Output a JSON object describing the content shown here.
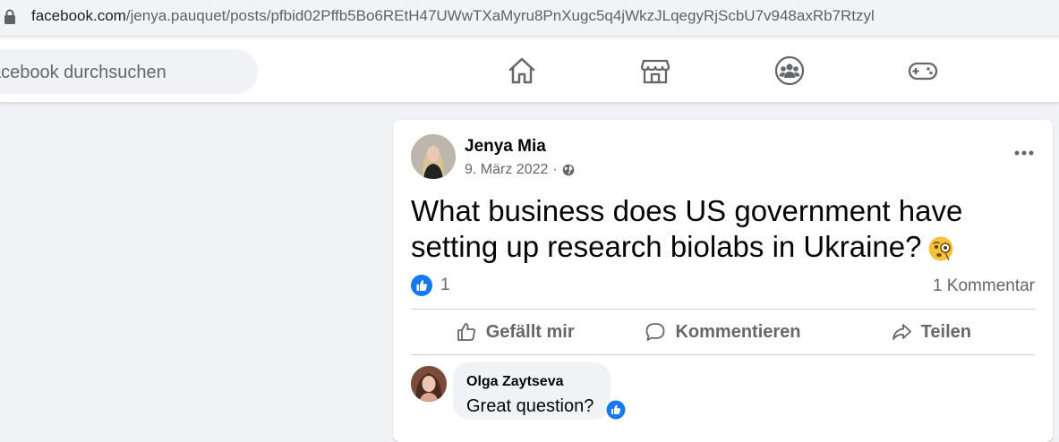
{
  "browser": {
    "url_domain": "facebook.com",
    "url_path": "/jenya.pauquet/posts/pfbid02Pffb5Bo6REtH47UWwTXaMyru8PnXugc5q4jWkzJLqegyRjScbU7v948axRb7Rtzyl"
  },
  "header": {
    "search_placeholder": "acebook durchsuchen",
    "nav": [
      "home-icon",
      "marketplace-icon",
      "groups-icon",
      "gaming-icon"
    ]
  },
  "post": {
    "author": "Jenya Mia",
    "date": "9. März 2022",
    "separator": "·",
    "text": "What business does US government have setting up research biolabs in Ukraine?",
    "like_count": "1",
    "comment_count": "1 Kommentar",
    "actions": {
      "like": "Gefällt mir",
      "comment": "Kommentieren",
      "share": "Teilen"
    }
  },
  "comment": {
    "author": "Olga Zaytseva",
    "text": "Great question?"
  },
  "colors": {
    "fb_blue": "#1877f2",
    "secondary_text": "#65676b",
    "background": "#f0f2f5"
  }
}
